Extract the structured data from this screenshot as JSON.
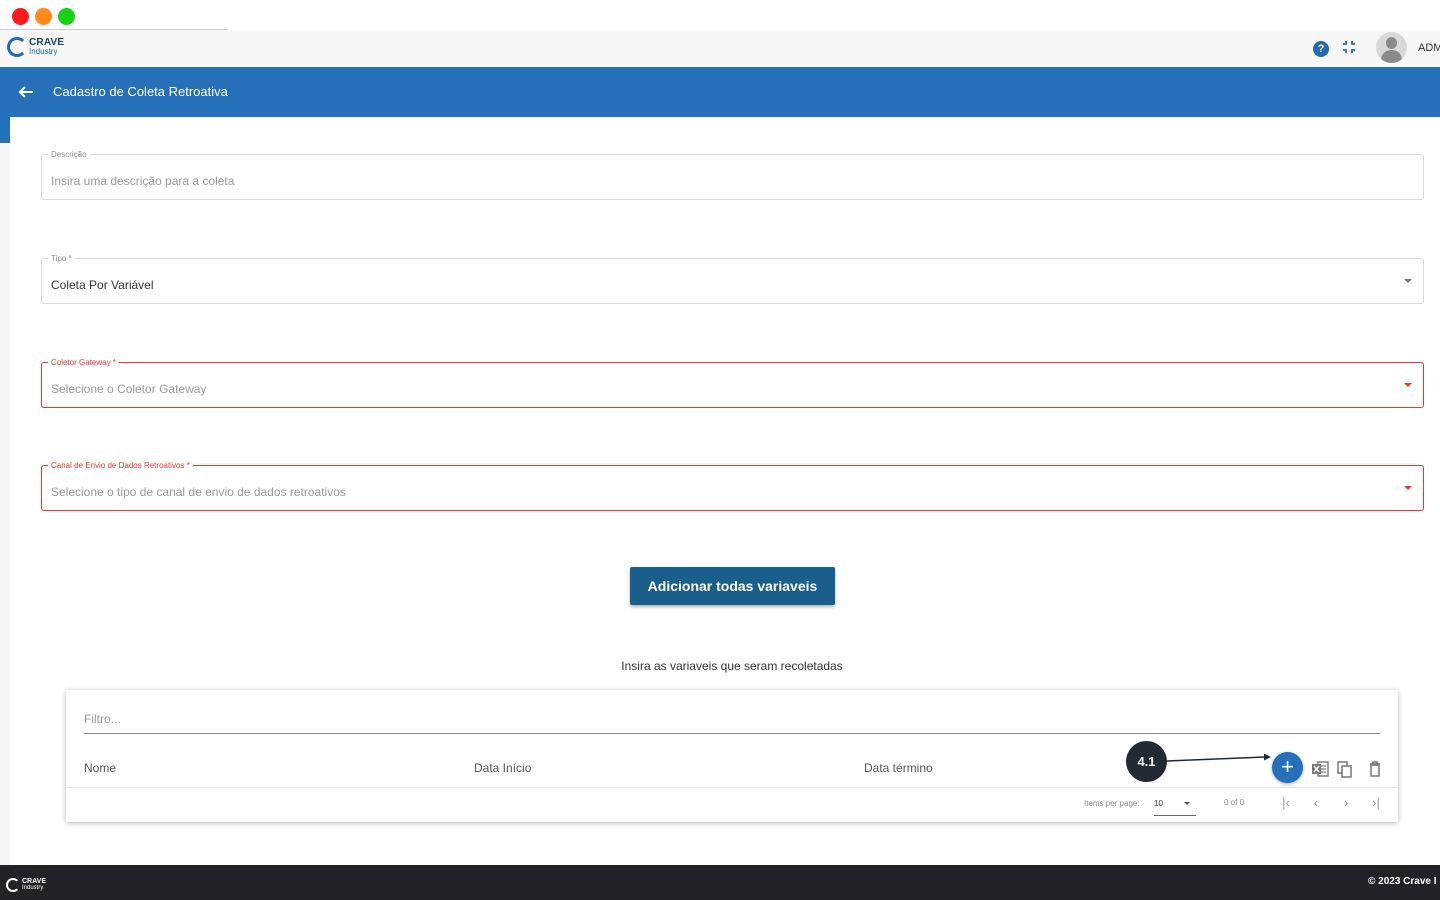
{
  "app": {
    "logo_name": "CRAVE",
    "logo_sub": "Industry",
    "user": "ADM",
    "brand_color": "#2570b8"
  },
  "header": {
    "title": "Cadastro de Coleta Retroativa"
  },
  "form": {
    "descricao": {
      "label": "Descrição",
      "placeholder": "Insira uma descrição para a coleta"
    },
    "tipo": {
      "label": "Tipo *",
      "value": "Coleta Por Variável"
    },
    "gateway": {
      "label": "Coletor Gateway *",
      "placeholder": "Selecione o Coletor Gateway"
    },
    "canal": {
      "label": "Canal de Envio de Dados Retroativos *",
      "placeholder": "Selecione o tipo de canal de envio de dados retroativos"
    },
    "add_all_label": "Adicionar todas variaveis"
  },
  "variables": {
    "caption": "Insira as variaveis que seram recoletadas",
    "filter_placeholder": "Filtro...",
    "columns": [
      "Nome",
      "Data Início",
      "Data término"
    ],
    "add_label": "+",
    "paginator": {
      "items_per_page_label": "Items per page:",
      "page_size": "10",
      "range": "0 of 0"
    }
  },
  "annotation": {
    "step": "4.1"
  },
  "footer": {
    "logo_name": "CRAVE",
    "logo_sub": "Industry",
    "copyright": "© 2023 Crave I"
  }
}
